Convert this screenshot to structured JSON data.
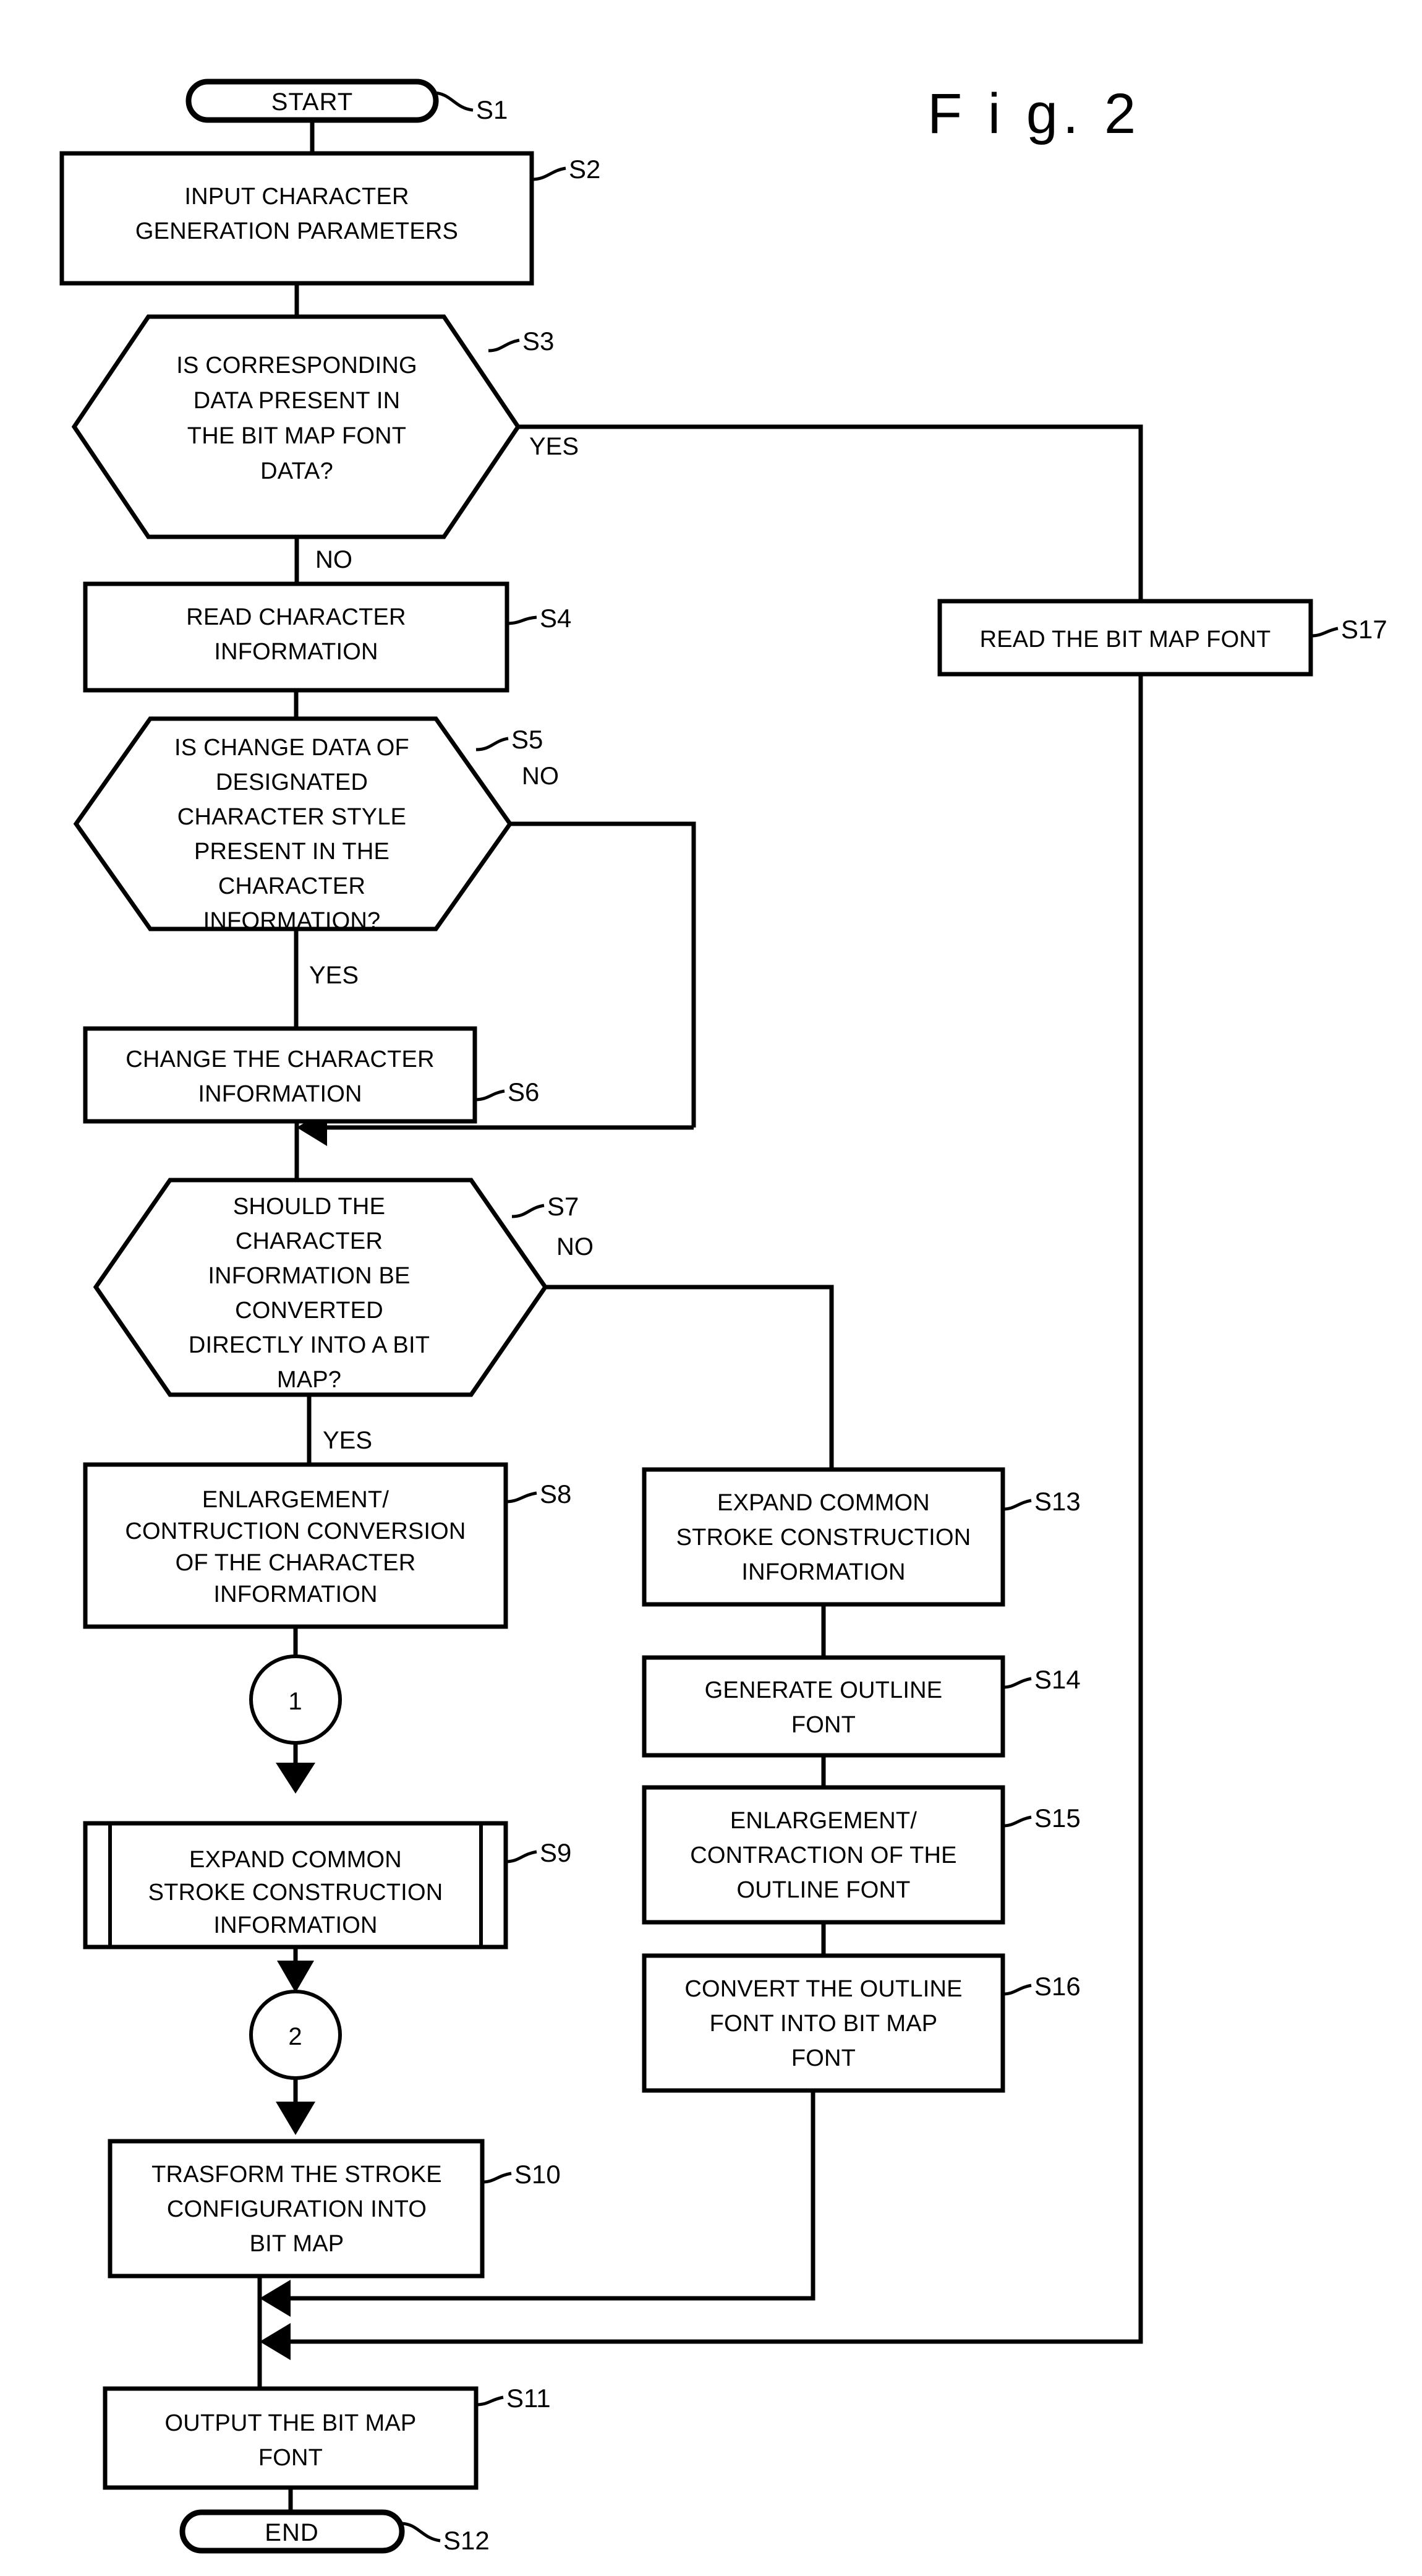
{
  "figure": {
    "title": "F i g. 2",
    "type": "flowchart"
  },
  "nodes": {
    "s1": {
      "id": "S1",
      "shape": "terminator",
      "text": "START"
    },
    "s2": {
      "id": "S2",
      "shape": "process",
      "lines": [
        "INPUT CHARACTER",
        "GENERATION PARAMETERS"
      ]
    },
    "s3": {
      "id": "S3",
      "shape": "decision-hexagon",
      "lines": [
        "IS CORRESPONDING",
        "DATA PRESENT IN",
        "THE BIT MAP FONT",
        "DATA?"
      ]
    },
    "s4": {
      "id": "S4",
      "shape": "process",
      "lines": [
        "READ CHARACTER",
        "INFORMATION"
      ]
    },
    "s5": {
      "id": "S5",
      "shape": "decision-hexagon",
      "lines": [
        "IS CHANGE DATA OF",
        "DESIGNATED",
        "CHARACTER STYLE",
        "PRESENT IN THE",
        "CHARACTER",
        "INFORMATION?"
      ]
    },
    "s6": {
      "id": "S6",
      "shape": "process",
      "lines": [
        "CHANGE THE CHARACTER",
        "INFORMATION"
      ]
    },
    "s7": {
      "id": "S7",
      "shape": "decision-hexagon",
      "lines": [
        "SHOULD THE",
        "CHARACTER",
        "INFORMATION BE",
        "CONVERTED",
        "DIRECTLY INTO A BIT",
        "MAP?"
      ]
    },
    "s8": {
      "id": "S8",
      "shape": "process",
      "lines": [
        "ENLARGEMENT/",
        "CONTRUCTION CONVERSION",
        "OF THE CHARACTER",
        "INFORMATION"
      ]
    },
    "s9": {
      "id": "S9",
      "shape": "predefined-process",
      "lines": [
        "EXPAND COMMON",
        "STROKE CONSTRUCTION",
        "INFORMATION"
      ]
    },
    "s10": {
      "id": "S10",
      "shape": "process",
      "lines": [
        "TRASFORM THE STROKE",
        "CONFIGURATION INTO",
        "BIT MAP"
      ]
    },
    "s11": {
      "id": "S11",
      "shape": "process",
      "lines": [
        "OUTPUT THE BIT MAP",
        "FONT"
      ]
    },
    "s12": {
      "id": "S12",
      "shape": "terminator",
      "text": "END"
    },
    "s13": {
      "id": "S13",
      "shape": "process",
      "lines": [
        "EXPAND COMMON",
        "STROKE CONSTRUCTION",
        "INFORMATION"
      ]
    },
    "s14": {
      "id": "S14",
      "shape": "process",
      "lines": [
        "GENERATE OUTLINE",
        "FONT"
      ]
    },
    "s15": {
      "id": "S15",
      "shape": "process",
      "lines": [
        "ENLARGEMENT/",
        "CONTRACTION OF THE",
        "OUTLINE FONT"
      ]
    },
    "s16": {
      "id": "S16",
      "shape": "process",
      "lines": [
        "CONVERT THE OUTLINE",
        "FONT INTO BIT MAP",
        "FONT"
      ]
    },
    "s17": {
      "id": "S17",
      "shape": "process",
      "lines": [
        "READ THE BIT MAP FONT"
      ]
    }
  },
  "connectors": {
    "c1": {
      "label": "1",
      "shape": "off-page-circle"
    },
    "c2": {
      "label": "2",
      "shape": "off-page-circle"
    }
  },
  "branch_labels": {
    "s3_yes": "YES",
    "s3_no": "NO",
    "s5_no": "NO",
    "s5_yes": "YES",
    "s7_no": "NO",
    "s7_yes": "YES"
  },
  "colors": {
    "stroke": "#000000",
    "fill": "#ffffff",
    "background": "#ffffff"
  }
}
